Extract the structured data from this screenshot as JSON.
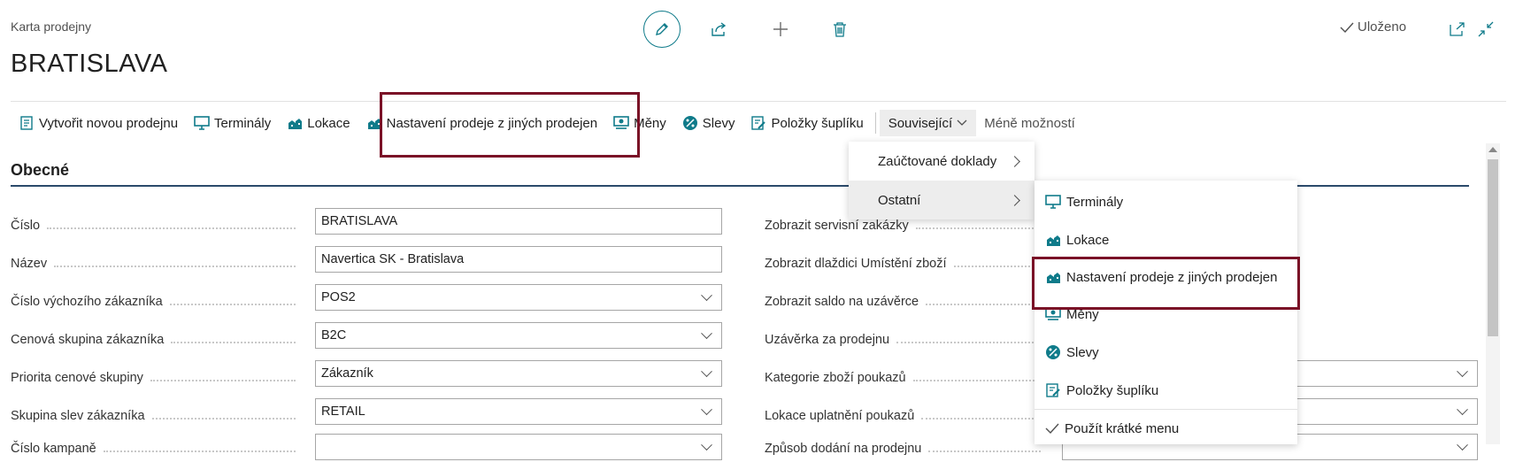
{
  "header": {
    "caption": "Karta prodejny",
    "title": "BRATISLAVA",
    "saved_label": "Uloženo"
  },
  "actions": {
    "new_store": "Vytvořit novou prodejnu",
    "terminals": "Terminály",
    "locations": "Lokace",
    "sales_setup": "Nastavení prodeje z jiných prodejen",
    "currencies": "Měny",
    "discounts": "Slevy",
    "drawer_items": "Položky šuplíku",
    "related": "Související",
    "fewer_options": "Méně možností"
  },
  "section": {
    "title": "Obecné"
  },
  "fields_left": [
    {
      "label": "Číslo",
      "value": "BRATISLAVA",
      "dropdown": false
    },
    {
      "label": "Název",
      "value": "Navertica SK - Bratislava",
      "dropdown": false
    },
    {
      "label": "Číslo výchozího zákazníka",
      "value": "POS2",
      "dropdown": true
    },
    {
      "label": "Cenová skupina zákazníka",
      "value": "B2C",
      "dropdown": true
    },
    {
      "label": "Priorita cenové skupiny",
      "value": "Zákazník",
      "dropdown": true
    },
    {
      "label": "Skupina slev zákazníka",
      "value": "RETAIL",
      "dropdown": true
    },
    {
      "label": "Číslo kampaně",
      "value": "",
      "dropdown": true
    }
  ],
  "fields_right": [
    {
      "label": "Zobrazit servisní zakázky"
    },
    {
      "label": "Zobrazit dlaždici Umístění zboží"
    },
    {
      "label": "Zobrazit saldo na uzávěrce"
    },
    {
      "label": "Uzávěrka za prodejnu"
    },
    {
      "label": "Kategorie zboží poukazů"
    },
    {
      "label": "Lokace uplatnění poukazů"
    },
    {
      "label": "Způsob dodání na prodejnu"
    }
  ],
  "related_menu": {
    "posted_docs": "Zaúčtované doklady",
    "other": "Ostatní"
  },
  "submenu": {
    "terminals": "Terminály",
    "locations": "Lokace",
    "sales_setup": "Nastavení prodeje z jiných prodejen",
    "currencies": "Měny",
    "discounts": "Slevy",
    "drawer_items": "Položky šuplíku",
    "short_menu": "Použít krátké menu"
  },
  "colors": {
    "accent": "#0f7b8a",
    "highlight_box": "#7a1127"
  }
}
